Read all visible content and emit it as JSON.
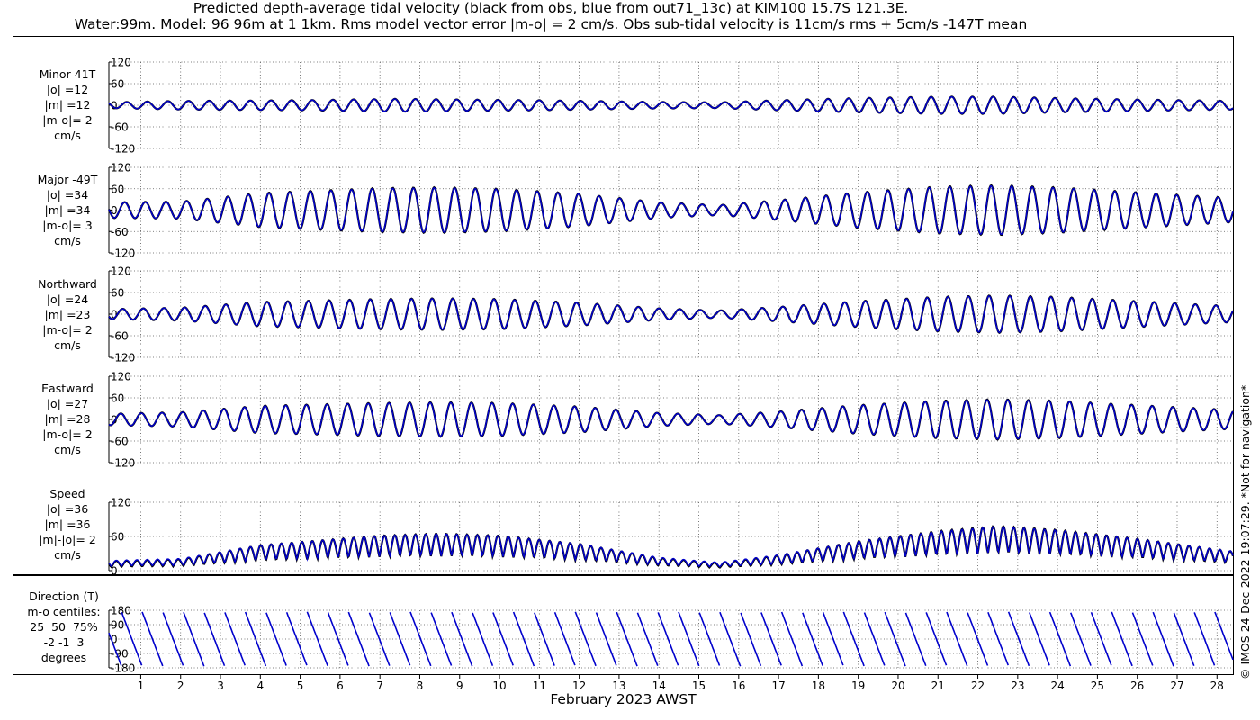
{
  "header": {
    "title_line1": "Predicted depth-average tidal velocity (black from obs, blue from out71_13c) at KIM100 15.7S 121.3E.",
    "title_line2": "Water:99m. Model: 96 96m at 1 1km. Rms model vector error |m-o| = 2 cm/s. Obs sub-tidal velocity is 11cm/s rms + 5cm/s -147T mean"
  },
  "footer": {
    "credit": "© IMOS 24-Dec-2022 19:07:29. *Not for navigation*"
  },
  "colors": {
    "obs": "#000000",
    "model": "#0000cc",
    "grid": "#555555"
  },
  "chart_data": {
    "type": "line",
    "xlabel": "February 2023 AWST",
    "x_ticks": [
      "1",
      "2",
      "3",
      "4",
      "5",
      "6",
      "7",
      "8",
      "9",
      "10",
      "11",
      "12",
      "13",
      "14",
      "15",
      "16",
      "17",
      "18",
      "19",
      "20",
      "21",
      "22",
      "23",
      "24",
      "25",
      "26",
      "27",
      "28"
    ],
    "xlim": [
      0.2,
      28.4
    ],
    "grid": true,
    "tidal_period_days": 0.5175,
    "series_names": [
      "obs",
      "model"
    ],
    "panels": [
      {
        "label_lines": [
          "Minor 41T",
          "|o| =12",
          "|m| =12",
          "|m-o|= 2",
          "cm/s"
        ],
        "ylim": [
          -120,
          120
        ],
        "yticks": [
          "120",
          "60",
          "0",
          "-60",
          "-120"
        ],
        "envelope": [
          [
            0.2,
            8
          ],
          [
            2,
            12
          ],
          [
            5,
            14
          ],
          [
            7.5,
            18
          ],
          [
            9,
            16
          ],
          [
            11,
            14
          ],
          [
            14,
            9
          ],
          [
            15.5,
            8
          ],
          [
            17,
            14
          ],
          [
            19,
            20
          ],
          [
            21,
            24
          ],
          [
            22.5,
            24
          ],
          [
            24,
            20
          ],
          [
            26,
            16
          ],
          [
            28.4,
            12
          ]
        ]
      },
      {
        "label_lines": [
          "Major -49T",
          "|o| =34",
          "|m| =34",
          "|m-o|= 3",
          "cm/s"
        ],
        "ylim": [
          -120,
          120
        ],
        "yticks": [
          "120",
          "60",
          "0",
          "-60",
          "-120"
        ],
        "envelope": [
          [
            0.2,
            22
          ],
          [
            2,
            24
          ],
          [
            4,
            48
          ],
          [
            7,
            62
          ],
          [
            8.5,
            64
          ],
          [
            10,
            60
          ],
          [
            12,
            46
          ],
          [
            14,
            22
          ],
          [
            15.5,
            14
          ],
          [
            17,
            28
          ],
          [
            19,
            50
          ],
          [
            21,
            66
          ],
          [
            22.5,
            70
          ],
          [
            24,
            64
          ],
          [
            26,
            50
          ],
          [
            28.4,
            34
          ]
        ]
      },
      {
        "label_lines": [
          "Northward",
          "|o| =24",
          "|m| =23",
          "|m-o|= 2",
          "cm/s"
        ],
        "ylim": [
          -120,
          120
        ],
        "yticks": [
          "120",
          "60",
          "0",
          "-60",
          "-120"
        ],
        "envelope": [
          [
            0.2,
            14
          ],
          [
            2,
            18
          ],
          [
            4,
            34
          ],
          [
            7,
            42
          ],
          [
            8.5,
            44
          ],
          [
            10,
            42
          ],
          [
            12,
            32
          ],
          [
            14,
            16
          ],
          [
            15.5,
            10
          ],
          [
            17,
            20
          ],
          [
            19,
            36
          ],
          [
            21,
            48
          ],
          [
            22.5,
            52
          ],
          [
            24,
            48
          ],
          [
            26,
            36
          ],
          [
            28.4,
            22
          ]
        ]
      },
      {
        "label_lines": [
          "Eastward",
          "|o| =27",
          "|m| =28",
          "|m-o|= 2",
          "cm/s"
        ],
        "ylim": [
          -120,
          120
        ],
        "yticks": [
          "120",
          "60",
          "0",
          "-60",
          "-120"
        ],
        "envelope": [
          [
            0.2,
            16
          ],
          [
            2,
            20
          ],
          [
            4,
            38
          ],
          [
            7,
            46
          ],
          [
            8.5,
            48
          ],
          [
            10,
            46
          ],
          [
            12,
            36
          ],
          [
            14,
            18
          ],
          [
            15.5,
            12
          ],
          [
            17,
            22
          ],
          [
            19,
            40
          ],
          [
            21,
            52
          ],
          [
            22.5,
            56
          ],
          [
            24,
            52
          ],
          [
            26,
            40
          ],
          [
            28.4,
            26
          ]
        ]
      },
      {
        "label_lines": [
          "Speed",
          "|o| =36",
          "|m| =36",
          "|m|-|o|= 2",
          "cm/s"
        ],
        "ylim": [
          0,
          120
        ],
        "yticks": [
          "120",
          "60",
          "0"
        ],
        "speed_envelope": [
          [
            0.2,
            15
          ],
          [
            2,
            18
          ],
          [
            4,
            40
          ],
          [
            7,
            55
          ],
          [
            8.5,
            58
          ],
          [
            10,
            55
          ],
          [
            12,
            42
          ],
          [
            14,
            20
          ],
          [
            15.5,
            12
          ],
          [
            17,
            24
          ],
          [
            19,
            46
          ],
          [
            21,
            62
          ],
          [
            22.5,
            70
          ],
          [
            24,
            64
          ],
          [
            26,
            50
          ],
          [
            28.4,
            30
          ]
        ]
      },
      {
        "label_lines": [
          "Direction (T)",
          "m-o centiles:",
          "25  50  75%",
          "-2 -1  3",
          "degrees"
        ],
        "ylim": [
          -180,
          180
        ],
        "yticks": [
          "180",
          "90",
          "0",
          "-90",
          "-180"
        ]
      }
    ]
  }
}
